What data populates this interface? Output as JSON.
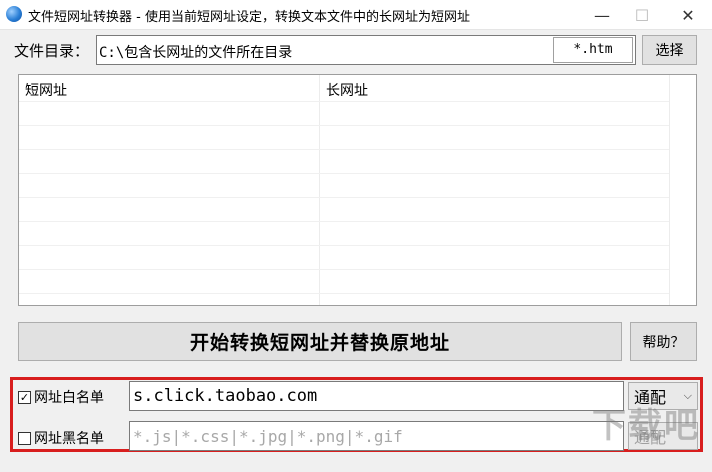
{
  "window": {
    "title": "文件短网址转换器 - 使用当前短网址设定，转换文本文件中的长网址为短网址",
    "minimize_glyph": "—",
    "maximize_glyph": "☐",
    "close_glyph": "✕"
  },
  "directory": {
    "label": "文件目录：",
    "value": "C:\\包含长网址的文件所在目录",
    "extension": "*.htm",
    "browse_label": "选择"
  },
  "list": {
    "columns": [
      "短网址",
      "长网址"
    ],
    "rows": []
  },
  "actions": {
    "start_label": "开始转换短网址并替换原地址",
    "help_label": "帮助？"
  },
  "whitelist": {
    "checkbox_label": "网址白名单",
    "checked": true,
    "value": "s.click.taobao.com",
    "match_mode": "通配"
  },
  "blacklist": {
    "checkbox_label": "网址黑名单",
    "checked": false,
    "placeholder": "*.js|*.css|*.jpg|*.png|*.gif",
    "match_mode": "通配"
  },
  "colors": {
    "highlight_frame": "#d81e1e",
    "window_bg": "#f0f0f0",
    "button_bg": "#e1e1e1"
  }
}
